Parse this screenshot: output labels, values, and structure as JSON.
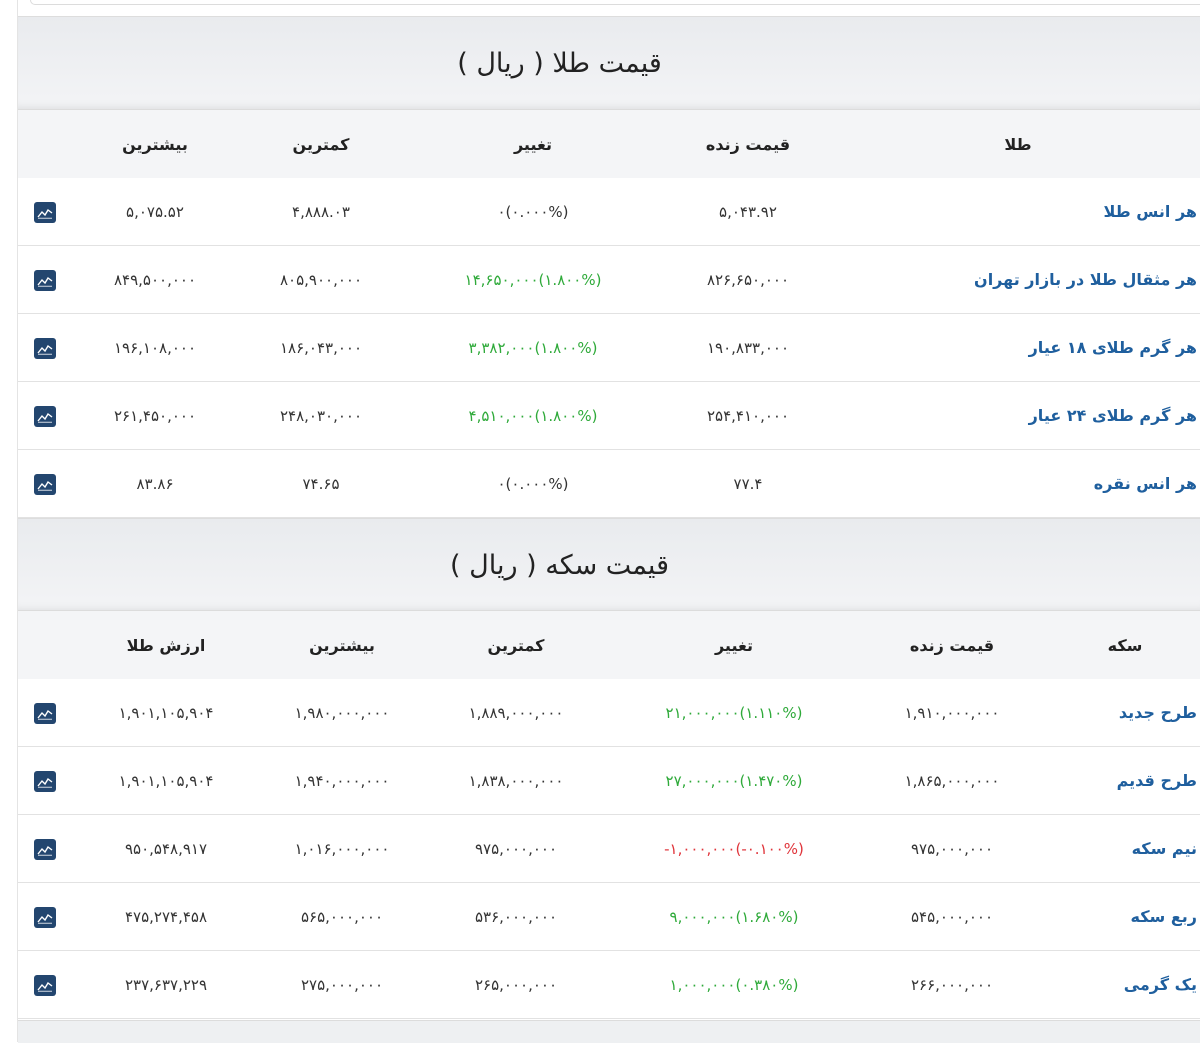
{
  "gold": {
    "title": "قیمت طلا ( ریال )",
    "headers": {
      "name": "طلا",
      "live": "قیمت زنده",
      "change": "تغییر",
      "low": "کمترین",
      "high": "بیشترین"
    },
    "rows": [
      {
        "name": "هر انس طلا",
        "live": "۵,۰۴۳.۹۲",
        "change_amount": "۰",
        "change_pct": "(۰.۰۰۰%)",
        "direction": "flat",
        "low": "۴,۸۸۸.۰۳",
        "high": "۵,۰۷۵.۵۲"
      },
      {
        "name": "هر مثقال طلا در بازار تهران",
        "live": "۸۲۶,۶۵۰,۰۰۰",
        "change_amount": "۱۴,۶۵۰,۰۰۰",
        "change_pct": "(۱.۸۰۰%)",
        "direction": "up",
        "low": "۸۰۵,۹۰۰,۰۰۰",
        "high": "۸۴۹,۵۰۰,۰۰۰"
      },
      {
        "name": "هر گرم طلای ۱۸ عیار",
        "live": "۱۹۰,۸۳۳,۰۰۰",
        "change_amount": "۳,۳۸۲,۰۰۰",
        "change_pct": "(۱.۸۰۰%)",
        "direction": "up",
        "low": "۱۸۶,۰۴۳,۰۰۰",
        "high": "۱۹۶,۱۰۸,۰۰۰"
      },
      {
        "name": "هر گرم طلای ۲۴ عیار",
        "live": "۲۵۴,۴۱۰,۰۰۰",
        "change_amount": "۴,۵۱۰,۰۰۰",
        "change_pct": "(۱.۸۰۰%)",
        "direction": "up",
        "low": "۲۴۸,۰۳۰,۰۰۰",
        "high": "۲۶۱,۴۵۰,۰۰۰"
      },
      {
        "name": "هر انس نقره",
        "live": "۷۷.۴",
        "change_amount": "۰",
        "change_pct": "(۰.۰۰۰%)",
        "direction": "flat",
        "low": "۷۴.۶۵",
        "high": "۸۳.۸۶"
      }
    ]
  },
  "coin": {
    "title": "قیمت سکه ( ریال )",
    "headers": {
      "name": "سکه",
      "live": "قیمت زنده",
      "change": "تغییر",
      "low": "کمترین",
      "high": "بیشترین",
      "gold_value": "ارزش طلا"
    },
    "rows": [
      {
        "name": "طرح جدید",
        "live": "۱,۹۱۰,۰۰۰,۰۰۰",
        "change_amount": "۲۱,۰۰۰,۰۰۰",
        "change_pct": "(۱.۱۱۰%)",
        "direction": "up",
        "low": "۱,۸۸۹,۰۰۰,۰۰۰",
        "high": "۱,۹۸۰,۰۰۰,۰۰۰",
        "gold_value": "۱,۹۰۱,۱۰۵,۹۰۴"
      },
      {
        "name": "طرح قدیم",
        "live": "۱,۸۶۵,۰۰۰,۰۰۰",
        "change_amount": "۲۷,۰۰۰,۰۰۰",
        "change_pct": "(۱.۴۷۰%)",
        "direction": "up",
        "low": "۱,۸۳۸,۰۰۰,۰۰۰",
        "high": "۱,۹۴۰,۰۰۰,۰۰۰",
        "gold_value": "۱,۹۰۱,۱۰۵,۹۰۴"
      },
      {
        "name": "نیم سکه",
        "live": "۹۷۵,۰۰۰,۰۰۰",
        "change_amount": "-۱,۰۰۰,۰۰۰",
        "change_pct": "(-۰.۱۰۰%)",
        "direction": "down",
        "low": "۹۷۵,۰۰۰,۰۰۰",
        "high": "۱,۰۱۶,۰۰۰,۰۰۰",
        "gold_value": "۹۵۰,۵۴۸,۹۱۷"
      },
      {
        "name": "ربع سکه",
        "live": "۵۴۵,۰۰۰,۰۰۰",
        "change_amount": "۹,۰۰۰,۰۰۰",
        "change_pct": "(۱.۶۸۰%)",
        "direction": "up",
        "low": "۵۳۶,۰۰۰,۰۰۰",
        "high": "۵۶۵,۰۰۰,۰۰۰",
        "gold_value": "۴۷۵,۲۷۴,۴۵۸"
      },
      {
        "name": "یک گرمی",
        "live": "۲۶۶,۰۰۰,۰۰۰",
        "change_amount": "۱,۰۰۰,۰۰۰",
        "change_pct": "(۰.۳۸۰%)",
        "direction": "up",
        "low": "۲۶۵,۰۰۰,۰۰۰",
        "high": "۲۷۵,۰۰۰,۰۰۰",
        "gold_value": "۲۳۷,۶۳۷,۲۲۹"
      }
    ]
  },
  "icons": {
    "chart": "chart-line-icon"
  },
  "colors": {
    "up": "#2faa3a",
    "down": "#e0353b",
    "flat": "#333333",
    "link": "#1f5f9e",
    "icon_bg": "#23466f"
  }
}
